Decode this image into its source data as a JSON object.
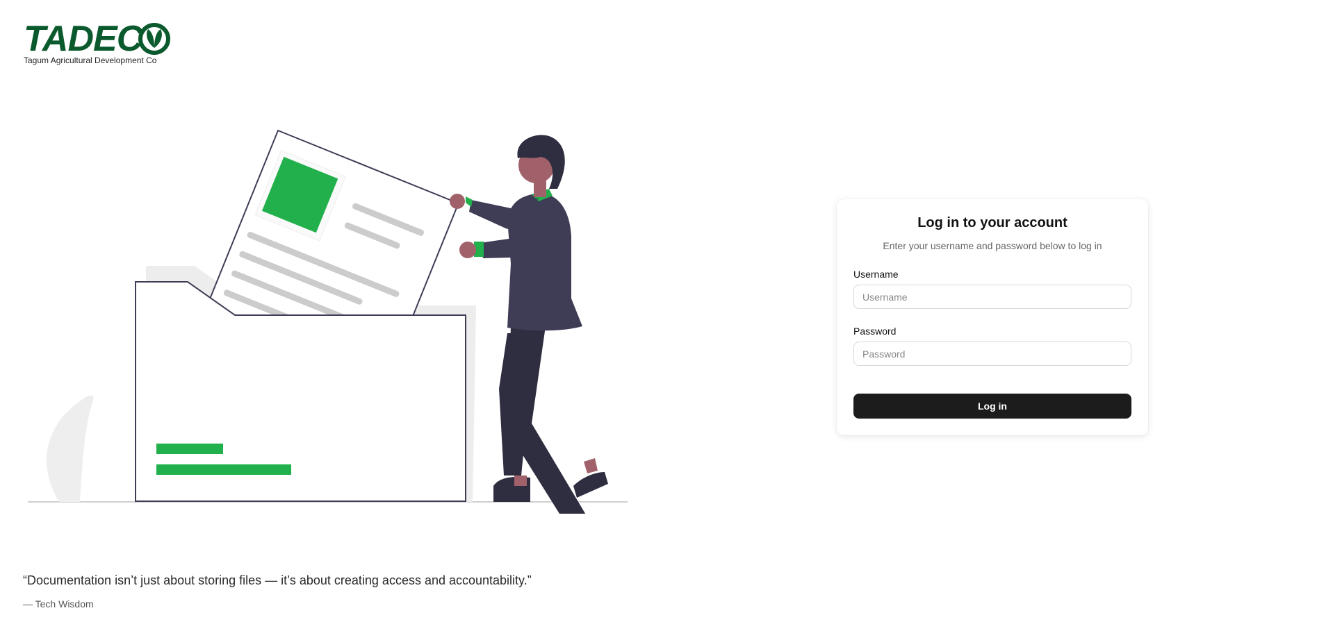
{
  "brand": {
    "logo_text": "TADECO",
    "logo_word": "TADEC",
    "tagline": "Tagum Agricultural Development Co",
    "brand_green": "#0b5a2e",
    "accent_green": "#21b04b"
  },
  "quote": {
    "text": "“Documentation isn’t just about storing files — it’s about creating access and accountability.”",
    "author": "— Tech Wisdom"
  },
  "login": {
    "title": "Log in to your account",
    "subtitle": "Enter your username and password below to log in",
    "username_label": "Username",
    "username_placeholder": "Username",
    "username_value": "",
    "password_label": "Password",
    "password_placeholder": "Password",
    "password_value": "",
    "submit_label": "Log in",
    "button_color": "#1c1c1c"
  }
}
